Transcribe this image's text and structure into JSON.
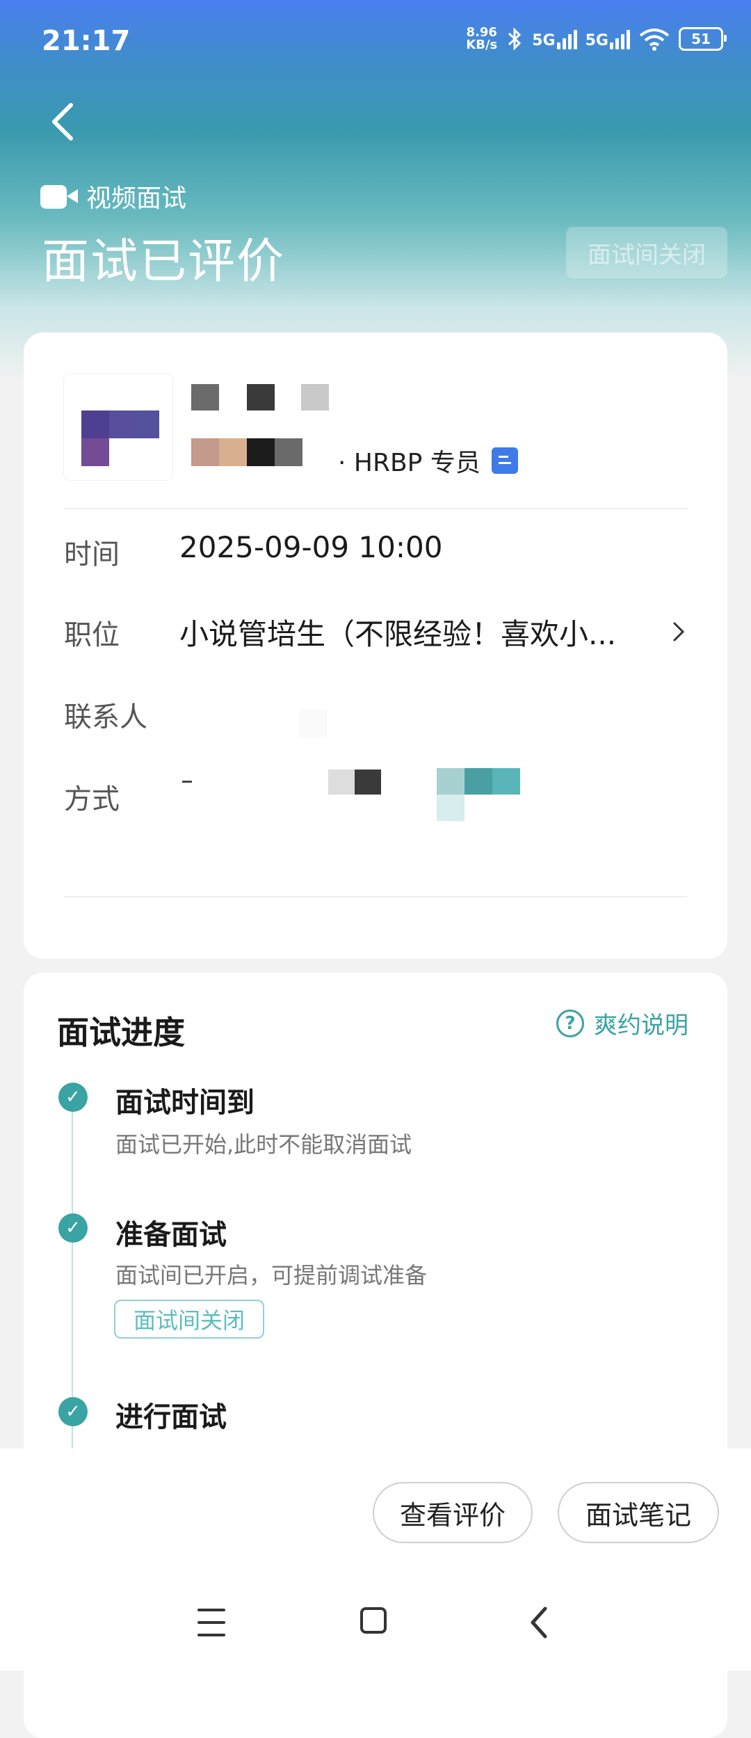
{
  "status_bar": {
    "time": "21:17",
    "net_speed_value": "8.96",
    "net_speed_unit": "KB/s",
    "signal1": "5G",
    "signal2": "5G",
    "battery": "51"
  },
  "header": {
    "type_label": "视频面试",
    "title": "面试已评价",
    "room_closed_label": "面试间关闭"
  },
  "interviewer": {
    "role": "· HRBP 专员"
  },
  "details": {
    "time_label": "时间",
    "time_value": "2025-09-09 10:00",
    "position_label": "职位",
    "position_value": "小说管培生（不限经验！喜欢小...",
    "contact_label": "联系人",
    "method_label": "方式"
  },
  "progress": {
    "title": "面试进度",
    "help_label": "爽约说明",
    "steps": [
      {
        "title": "面试时间到",
        "desc": "面试已开始,此时不能取消面试"
      },
      {
        "title": "准备面试",
        "desc": "面试间已开启，可提前调试准备",
        "tag": "面试间关闭"
      },
      {
        "title": "进行面试"
      }
    ]
  },
  "actions": {
    "view_eval": "查看评价",
    "notes": "面试笔记"
  },
  "colors": {
    "accent": "#3aa3a3",
    "badge_blue": "#3e7ae8"
  }
}
